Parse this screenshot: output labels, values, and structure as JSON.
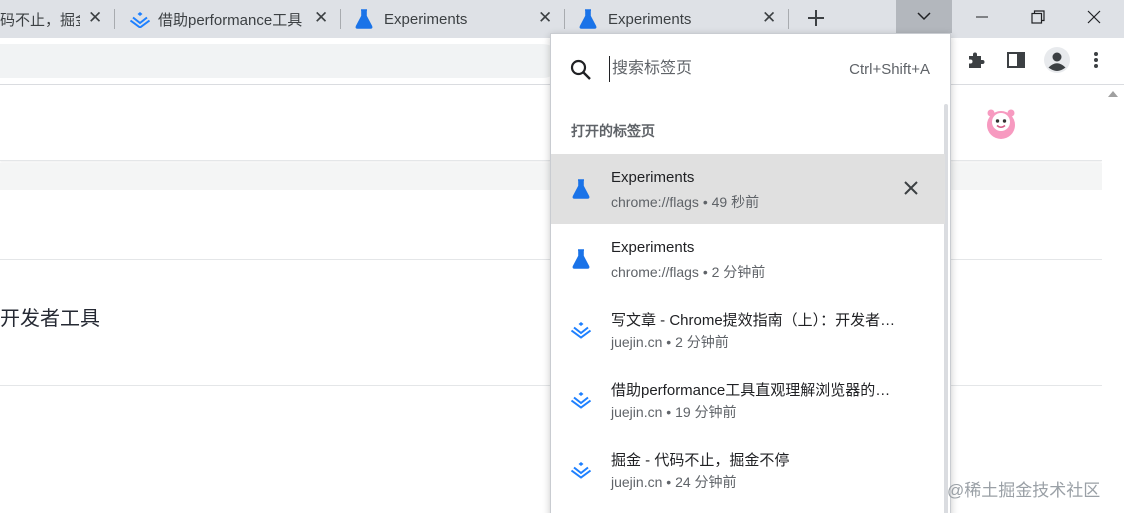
{
  "tabs": [
    {
      "title": "码不止，掘金",
      "icon": "juejin-icon"
    },
    {
      "title": "借助performance工具",
      "icon": "juejin-icon"
    },
    {
      "title": "Experiments",
      "icon": "flask-icon"
    },
    {
      "title": "Experiments",
      "icon": "flask-icon"
    }
  ],
  "tab_search": {
    "placeholder": "搜索标签页",
    "shortcut": "Ctrl+Shift+A",
    "section_title": "打开的标签页",
    "items": [
      {
        "title": "Experiments",
        "url": "chrome://flags",
        "age": "49 秒前",
        "icon": "flask-icon",
        "selected": true
      },
      {
        "title": "Experiments",
        "url": "chrome://flags",
        "age": "2 分钟前",
        "icon": "flask-icon"
      },
      {
        "title": "写文章 - Chrome提效指南（上）：开发者…",
        "url": "juejin.cn",
        "age": "2 分钟前",
        "icon": "juejin-icon"
      },
      {
        "title": "借助performance工具直观理解浏览器的…",
        "url": "juejin.cn",
        "age": "19 分钟前",
        "icon": "juejin-icon"
      },
      {
        "title": "掘金 - 代码不止，掘金不停",
        "url": "juejin.cn",
        "age": "24 分钟前",
        "icon": "juejin-icon"
      }
    ]
  },
  "page": {
    "heading_fragment": "开发者工具"
  },
  "watermark": "@稀土掘金技术社区",
  "colors": {
    "accent_blue": "#1a73e8",
    "juejin_blue": "#1e80ff",
    "tabstrip_bg": "#dee1e6"
  }
}
